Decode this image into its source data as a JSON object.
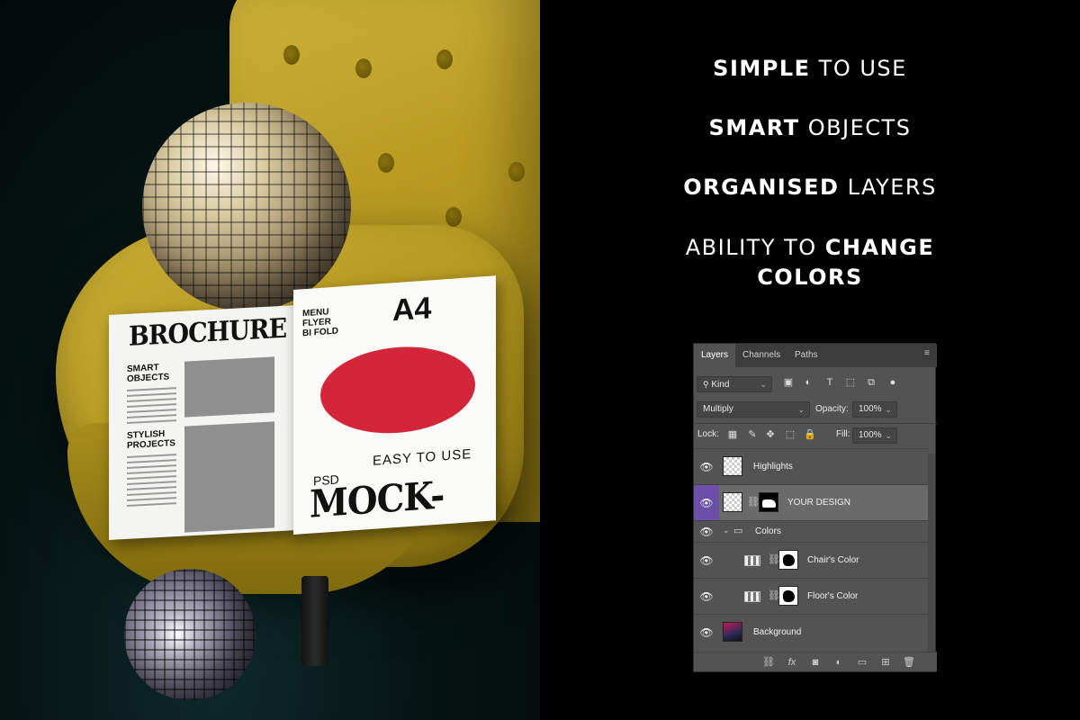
{
  "features": [
    {
      "bold": "SIMPLE",
      "rest": " TO USE"
    },
    {
      "bold": "SMART",
      "rest": " OBJECTS"
    },
    {
      "bold": "ORGANISED",
      "rest": " LAYERS"
    },
    {
      "prefix": "ABILITY TO ",
      "bold": "CHANGE",
      "line2": "COLORS"
    }
  ],
  "brochure": {
    "title": "BROCHURE",
    "smart": [
      "SMART",
      "OBJECTS"
    ],
    "stylish": [
      "STYLISH",
      "PROJECTS"
    ],
    "menu": [
      "MENU",
      "FLYER",
      "BI FOLD"
    ],
    "size": "A4",
    "easy": "EASY TO USE",
    "psd": "PSD",
    "mockup": "MOCK-UP"
  },
  "layers_panel": {
    "tabs": [
      "Layers",
      "Channels",
      "Paths"
    ],
    "filter_label": "Kind",
    "blend_mode": "Multiply",
    "opacity_label": "Opacity:",
    "opacity_value": "100%",
    "lock_label": "Lock:",
    "fill_label": "Fill:",
    "fill_value": "100%",
    "layers": [
      {
        "name": "Highlights"
      },
      {
        "name": "YOUR DESIGN",
        "selected": true
      },
      {
        "name": "Colors",
        "type": "group"
      },
      {
        "name": "Chair's Color"
      },
      {
        "name": "Floor's Color"
      },
      {
        "name": "Background"
      }
    ],
    "accent_color": "#6b4fa8"
  }
}
